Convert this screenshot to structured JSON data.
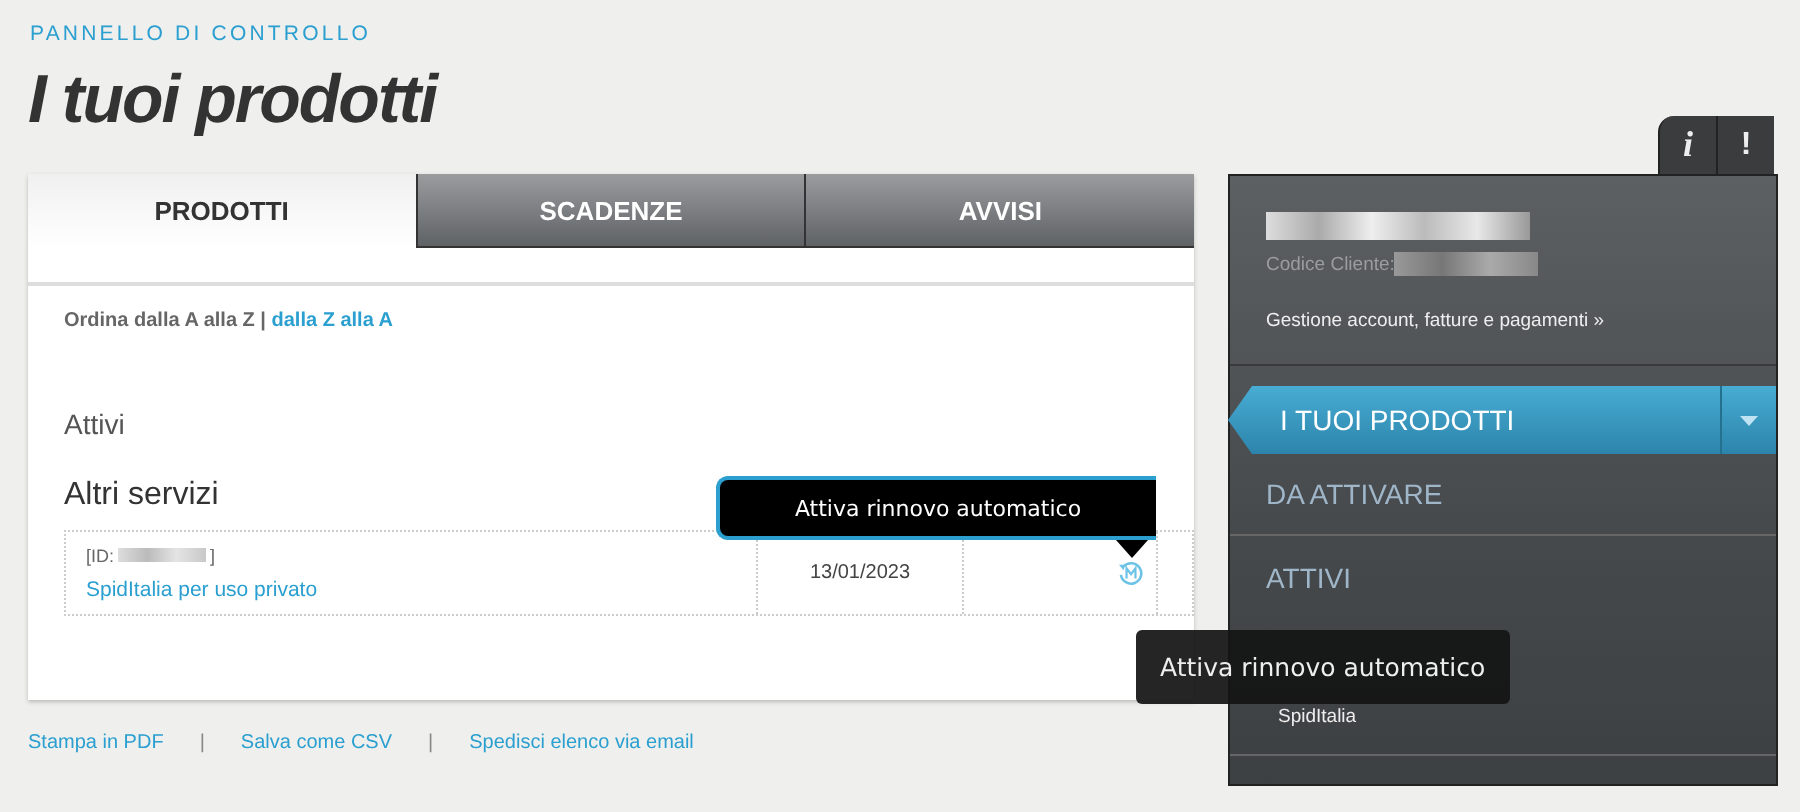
{
  "header": {
    "breadcrumb": "PANNELLO DI CONTROLLO",
    "title": "I tuoi prodotti"
  },
  "tabs": [
    {
      "label": "PRODOTTI",
      "selected": true
    },
    {
      "label": "SCADENZE",
      "selected": false
    },
    {
      "label": "AVVISI",
      "selected": false
    }
  ],
  "sort": {
    "label": "Ordina dalla A alla Z |",
    "link": "dalla Z alla A"
  },
  "section_title": "Attivi",
  "group_title": "Altri servizi",
  "products": [
    {
      "id_prefix": "[ID:",
      "id_suffix": "]",
      "name": "SpidItalia per uso privato",
      "expiry": "13/01/2023"
    }
  ],
  "popup": {
    "text": "Attiva rinnovo automatico"
  },
  "footer": [
    {
      "kind": "link",
      "text": "Stampa in PDF"
    },
    {
      "kind": "separator",
      "text": "|"
    },
    {
      "kind": "link",
      "text": "Salva come CSV"
    },
    {
      "kind": "separator",
      "text": "|"
    },
    {
      "kind": "link",
      "text": "Spedisci elenco via email"
    }
  ],
  "side_tabs": [
    {
      "label": "i"
    },
    {
      "label": "!"
    }
  ],
  "account": {
    "customer_code_label": "Codice Cliente:",
    "manage_link": "Gestione account, fatture e pagamenti »"
  },
  "menu": [
    {
      "label": "I TUOI PRODOTTI",
      "selected": true
    },
    {
      "label": "DA ATTIVARE",
      "selected": false
    },
    {
      "label": "ATTIVI",
      "selected": false,
      "children": [
        {
          "label": "SpidItalia"
        }
      ]
    }
  ],
  "tooltip": {
    "text": "Attiva rinnovo automatico"
  }
}
